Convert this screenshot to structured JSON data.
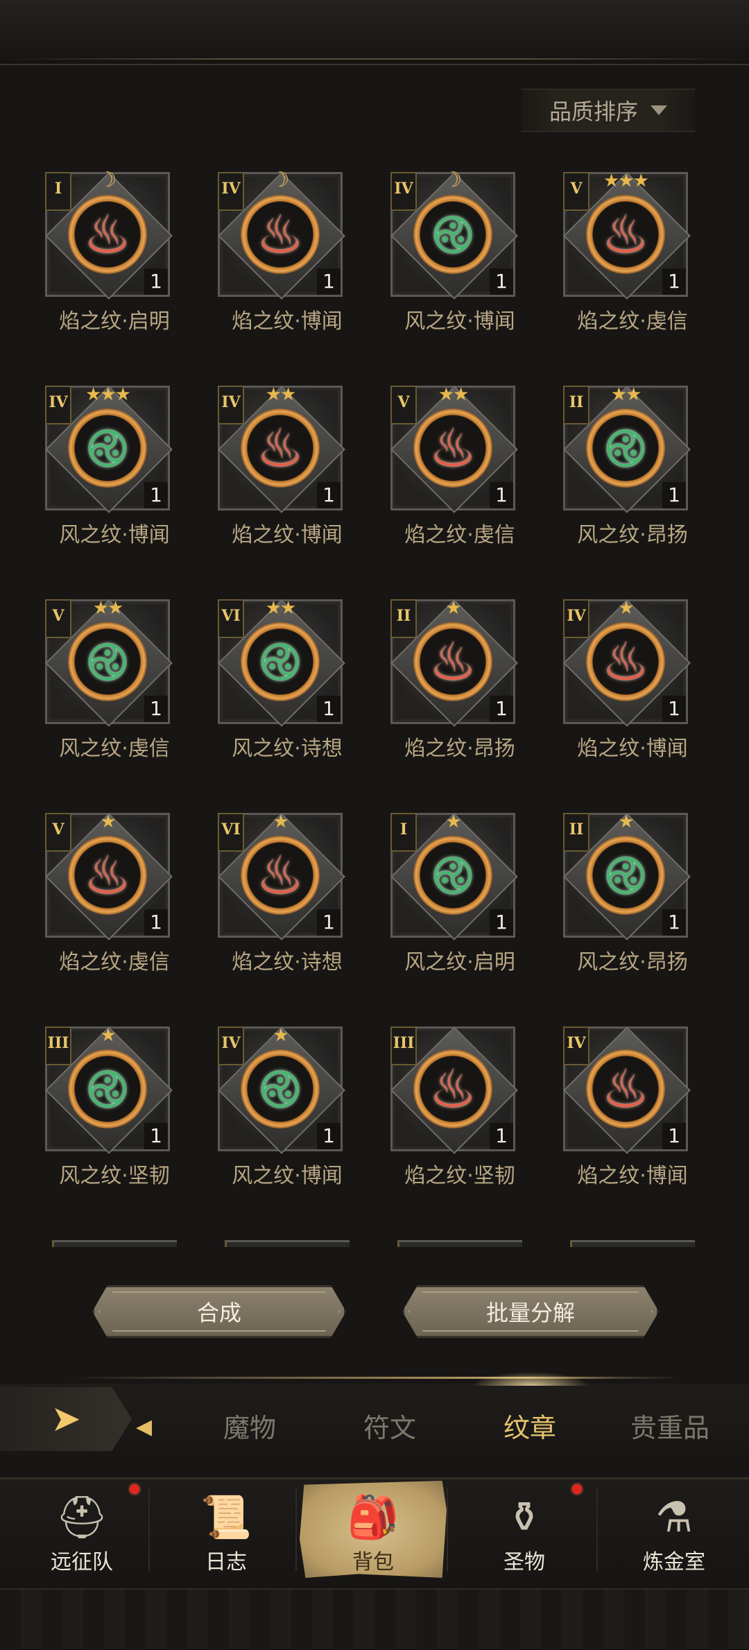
{
  "sort": {
    "label": "品质排序"
  },
  "items": [
    {
      "name": "焰之纹·启明",
      "tier": "I",
      "type": "fire",
      "badge": "☽",
      "count": "1"
    },
    {
      "name": "焰之纹·博闻",
      "tier": "IV",
      "type": "fire",
      "badge": "☽",
      "count": "1"
    },
    {
      "name": "风之纹·博闻",
      "tier": "IV",
      "type": "wind",
      "badge": "☽",
      "count": "1"
    },
    {
      "name": "焰之纹·虔信",
      "tier": "V",
      "type": "fire",
      "badge": "★★★",
      "count": "1"
    },
    {
      "name": "风之纹·博闻",
      "tier": "IV",
      "type": "wind",
      "badge": "★★★",
      "count": "1"
    },
    {
      "name": "焰之纹·博闻",
      "tier": "IV",
      "type": "fire",
      "badge": "★★",
      "count": "1"
    },
    {
      "name": "焰之纹·虔信",
      "tier": "V",
      "type": "fire",
      "badge": "★★",
      "count": "1"
    },
    {
      "name": "风之纹·昂扬",
      "tier": "II",
      "type": "wind",
      "badge": "★★",
      "count": "1"
    },
    {
      "name": "风之纹·虔信",
      "tier": "V",
      "type": "wind",
      "badge": "★★",
      "count": "1"
    },
    {
      "name": "风之纹·诗想",
      "tier": "VI",
      "type": "wind",
      "badge": "★★",
      "count": "1"
    },
    {
      "name": "焰之纹·昂扬",
      "tier": "II",
      "type": "fire",
      "badge": "★",
      "count": "1"
    },
    {
      "name": "焰之纹·博闻",
      "tier": "IV",
      "type": "fire",
      "badge": "★",
      "count": "1"
    },
    {
      "name": "焰之纹·虔信",
      "tier": "V",
      "type": "fire",
      "badge": "★",
      "count": "1"
    },
    {
      "name": "焰之纹·诗想",
      "tier": "VI",
      "type": "fire",
      "badge": "★",
      "count": "1"
    },
    {
      "name": "风之纹·启明",
      "tier": "I",
      "type": "wind",
      "badge": "★",
      "count": "1"
    },
    {
      "name": "风之纹·昂扬",
      "tier": "II",
      "type": "wind",
      "badge": "★",
      "count": "1"
    },
    {
      "name": "风之纹·坚韧",
      "tier": "III",
      "type": "wind",
      "badge": "★",
      "count": "1"
    },
    {
      "name": "风之纹·博闻",
      "tier": "IV",
      "type": "wind",
      "badge": "★",
      "count": "1"
    },
    {
      "name": "焰之纹·坚韧",
      "tier": "III",
      "type": "fire",
      "badge": "",
      "count": "1"
    },
    {
      "name": "焰之纹·博闻",
      "tier": "IV",
      "type": "fire",
      "badge": "",
      "count": "1"
    }
  ],
  "actions": {
    "synthesize": "合成",
    "bulk_decompose": "批量分解"
  },
  "tabs": [
    {
      "label": "魔物",
      "active": false
    },
    {
      "label": "符文",
      "active": false
    },
    {
      "label": "纹章",
      "active": true
    },
    {
      "label": "贵重品",
      "active": false
    }
  ],
  "nav": [
    {
      "label": "远征队",
      "icon": "viking-helmet-icon",
      "glyph": "⛑",
      "badge": true,
      "active": false
    },
    {
      "label": "日志",
      "icon": "scroll-icon",
      "glyph": "📜",
      "badge": false,
      "active": false
    },
    {
      "label": "背包",
      "icon": "backpack-icon",
      "glyph": "🎒",
      "badge": false,
      "active": true
    },
    {
      "label": "圣物",
      "icon": "brazier-icon",
      "glyph": "⚱",
      "badge": true,
      "active": false
    },
    {
      "label": "炼金室",
      "icon": "alchemy-icon",
      "glyph": "⚗",
      "badge": false,
      "active": false
    }
  ],
  "emblem_glyphs": {
    "fire": "♨",
    "wind": "࿋"
  }
}
